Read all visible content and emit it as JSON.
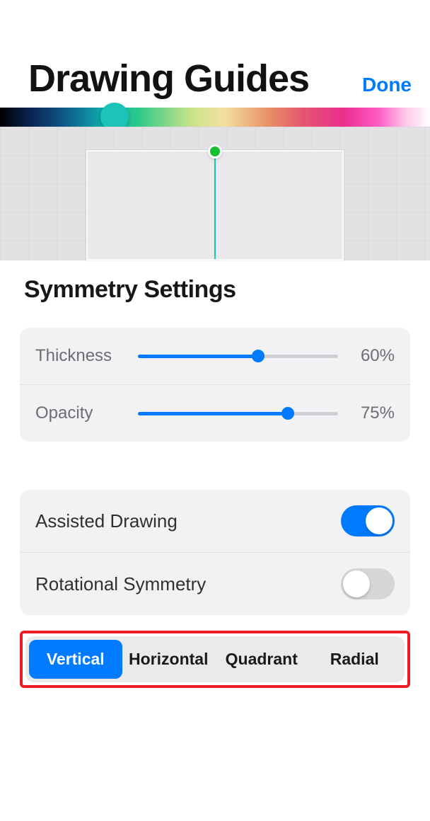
{
  "header": {
    "done_label": "Done",
    "title": "Drawing Guides"
  },
  "sheet": {
    "title": "Symmetry Settings",
    "sliders": {
      "thickness": {
        "label": "Thickness",
        "value": "60%",
        "percent": 60
      },
      "opacity": {
        "label": "Opacity",
        "value": "75%",
        "percent": 75
      }
    },
    "toggles": {
      "assisted": {
        "label": "Assisted Drawing",
        "on": true
      },
      "rotational": {
        "label": "Rotational Symmetry",
        "on": false
      }
    },
    "segments": [
      {
        "label": "Vertical",
        "active": true
      },
      {
        "label": "Horizontal",
        "active": false
      },
      {
        "label": "Quadrant",
        "active": false
      },
      {
        "label": "Radial",
        "active": false
      }
    ]
  },
  "colors": {
    "accent": "#007aff",
    "highlight_border": "#ec1c24"
  }
}
